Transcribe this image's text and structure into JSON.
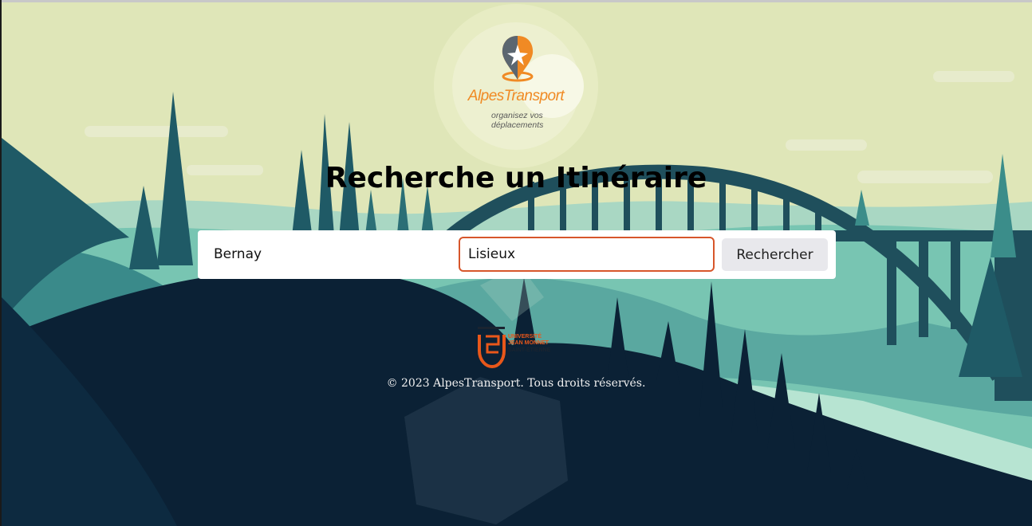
{
  "brand": {
    "name": "AlpesTransport",
    "tagline_line1": "organisez vos",
    "tagline_line2": "déplacements"
  },
  "page": {
    "title": "Recherche un Itinéraire"
  },
  "search": {
    "from_value": "Bernay",
    "to_value": "Lisieux",
    "button_label": "Rechercher"
  },
  "university": {
    "line1": "UNIVERSITÉ",
    "line2": "JEAN MONNET",
    "line3": "SAINT-ÉTIENNE"
  },
  "footer": {
    "text": "© 2023 AlpesTransport. Tous droits réservés."
  },
  "colors": {
    "accent_orange": "#f08a24",
    "focus_border": "#d7562b",
    "sky": "#dfe6b8",
    "night": "#0b2135",
    "teal": "#1f5a66"
  }
}
